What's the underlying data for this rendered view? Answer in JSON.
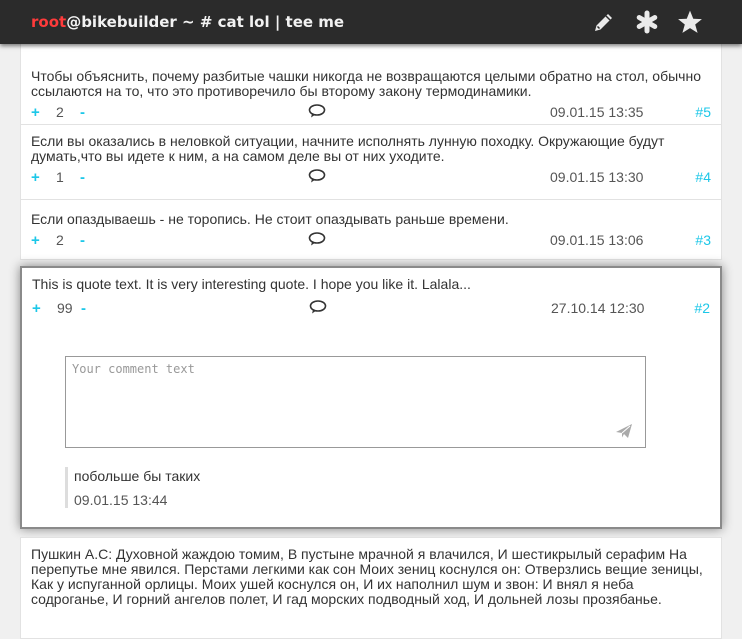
{
  "header": {
    "user": "root",
    "host_path": "@bikebuilder ~ # cat lol | tee me",
    "icons": [
      "pencil-icon",
      "asterisk-icon",
      "star-icon"
    ]
  },
  "posts": [
    {
      "text": "Чтобы объяснить, почему разбитые чашки никогда не возвращаются целыми обратно на стол, обычно ссылаются на то, что это противоречило бы второму закону термодинамики.",
      "plus": "+",
      "score": "2",
      "minus": "-",
      "date": "09.01.15 13:35",
      "num": "#5"
    },
    {
      "text": "Если вы оказались в неловкой ситуации, начните исполнять лунную походку. Окружающие будут думать,что вы идете к ним, а на самом деле вы от них уходите.",
      "plus": "+",
      "score": "1",
      "minus": "-",
      "date": "09.01.15 13:30",
      "num": "#4"
    },
    {
      "text": "Если опаздываешь - не торопись. Не стоит опаздывать раньше времени.",
      "plus": "+",
      "score": "2",
      "minus": "-",
      "date": "09.01.15 13:06",
      "num": "#3"
    }
  ],
  "active_post": {
    "text": "This is quote text. It is very interesting quote. I hope you like it. Lalala...",
    "plus": "+",
    "score": "99",
    "minus": "-",
    "date": "27.10.14 12:30",
    "num": "#2",
    "comment_placeholder": "Your comment text",
    "reply": {
      "text": "побольше бы таких",
      "date": "09.01.15 13:44"
    }
  },
  "last_post": {
    "text": "Пушкин А.С: Духовной жаждою томим, В пустыне мрачной я влачился, И шестикрылый серафим На перепутье мне явился. Перстами легкими как сон Моих зениц коснулся он: Отверзлись вещие зеницы, Как у испуганной орлицы. Моих ушей коснулся он, И их наполнил шум и звон: И внял я неба содроганье, И горний ангелов полет, И гад морских подводный ход, И дольней лозы прозябанье."
  },
  "colors": {
    "accent": "#1cc7e8",
    "user": "#ff3b3b",
    "header_bg": "#2b2b2b"
  }
}
